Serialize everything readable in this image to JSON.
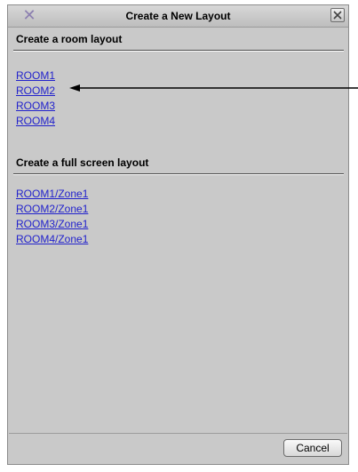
{
  "window": {
    "title": "Create a New Layout",
    "app_icon": "x-logo-icon",
    "close_icon": "close-icon"
  },
  "room_section": {
    "heading": "Create a room layout",
    "links": [
      "ROOM1",
      "ROOM2",
      "ROOM3",
      "ROOM4"
    ]
  },
  "fullscreen_section": {
    "heading": "Create a full screen layout",
    "links": [
      "ROOM1/Zone1",
      "ROOM2/Zone1",
      "ROOM3/Zone1",
      "ROOM4/Zone1"
    ]
  },
  "footer": {
    "cancel_label": "Cancel"
  },
  "annotation": {
    "arrow_target": "ROOM2"
  },
  "colors": {
    "link": "#2222cc",
    "dialog_bg": "#c9c9c9"
  }
}
